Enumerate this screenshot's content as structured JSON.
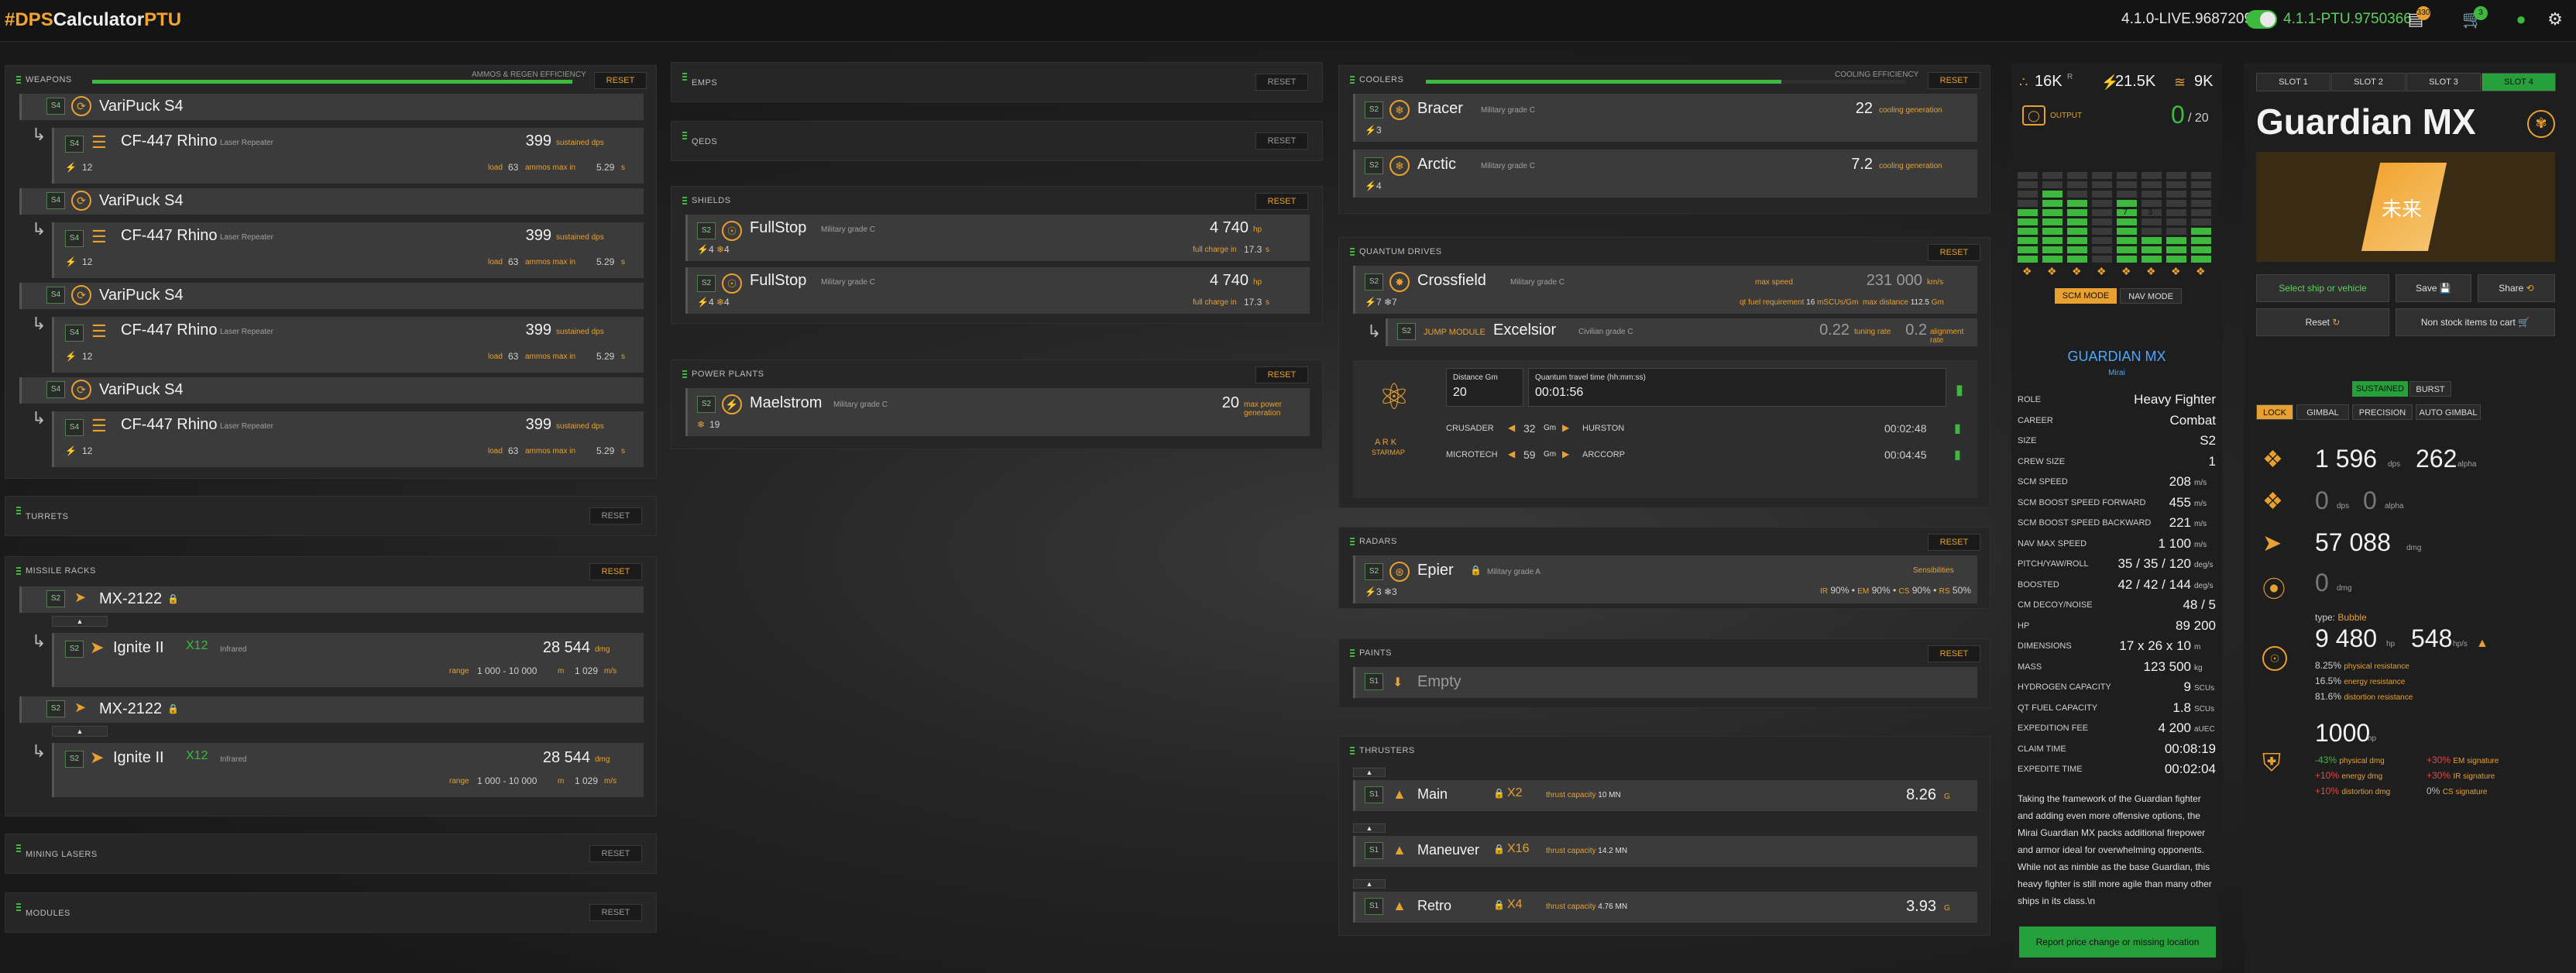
{
  "topbar": {
    "brand_prefix": "#DPS",
    "brand_mid": "Calculator",
    "brand_suffix": "PTU",
    "live_version": "4.1.0-LIVE.9687209",
    "ptu_version": "4.1.1-PTU.9750366",
    "notes_badge": "330",
    "cart_badge": "3"
  },
  "weapons": {
    "title": "WEAPONS",
    "efficiency_label": "AMMOS & REGEN EFFICIENCY",
    "reset": "RESET",
    "mounts": [
      {
        "size": "S4",
        "mount": "VariPuck S4",
        "wsize": "S4",
        "weapon": "CF-447 Rhino",
        "type": "Laser Repeater",
        "power": "12",
        "dps": "399",
        "dps_unit": "sustained dps",
        "load_label": "load",
        "ammo": "63",
        "ammo_label": "ammos max in",
        "time": "5.29",
        "time_unit": "s"
      },
      {
        "size": "S4",
        "mount": "VariPuck S4",
        "wsize": "S4",
        "weapon": "CF-447 Rhino",
        "type": "Laser Repeater",
        "power": "12",
        "dps": "399",
        "dps_unit": "sustained dps",
        "load_label": "load",
        "ammo": "63",
        "ammo_label": "ammos max in",
        "time": "5.29",
        "time_unit": "s"
      },
      {
        "size": "S4",
        "mount": "VariPuck S4",
        "wsize": "S4",
        "weapon": "CF-447 Rhino",
        "type": "Laser Repeater",
        "power": "12",
        "dps": "399",
        "dps_unit": "sustained dps",
        "load_label": "load",
        "ammo": "63",
        "ammo_label": "ammos max in",
        "time": "5.29",
        "time_unit": "s"
      },
      {
        "size": "S4",
        "mount": "VariPuck S4",
        "wsize": "S4",
        "weapon": "CF-447 Rhino",
        "type": "Laser Repeater",
        "power": "12",
        "dps": "399",
        "dps_unit": "sustained dps",
        "load_label": "load",
        "ammo": "63",
        "ammo_label": "ammos max in",
        "time": "5.29",
        "time_unit": "s"
      }
    ]
  },
  "turrets": {
    "title": "TURRETS",
    "reset": "RESET"
  },
  "missiles": {
    "title": "MISSILE RACKS",
    "reset": "RESET",
    "racks": [
      {
        "size": "S2",
        "rack": "MX-2122",
        "msize": "S2",
        "missile": "Ignite II",
        "count": "X12",
        "guidance": "Infrared",
        "dmg": "28 544",
        "dmg_unit": "dmg",
        "range_label": "range",
        "range": "1 000 - 10 000",
        "range_unit": "m",
        "speed": "1 029",
        "speed_unit": "m/s"
      },
      {
        "size": "S2",
        "rack": "MX-2122",
        "msize": "S2",
        "missile": "Ignite II",
        "count": "X12",
        "guidance": "Infrared",
        "dmg": "28 544",
        "dmg_unit": "dmg",
        "range_label": "range",
        "range": "1 000 - 10 000",
        "range_unit": "m",
        "speed": "1 029",
        "speed_unit": "m/s"
      }
    ]
  },
  "mining": {
    "title": "MINING LASERS",
    "reset": "RESET"
  },
  "modules": {
    "title": "MODULES",
    "reset": "RESET"
  },
  "emps": {
    "title": "EMPS",
    "reset": "RESET"
  },
  "qeds": {
    "title": "QEDS",
    "reset": "RESET"
  },
  "shields": {
    "title": "SHIELDS",
    "reset": "RESET",
    "items": [
      {
        "size": "S2",
        "name": "FullStop",
        "grade": "Military grade C",
        "power": "4",
        "cool": "4",
        "hp": "4 740",
        "hp_unit": "hp",
        "charge_label": "full charge in",
        "charge": "17.3",
        "charge_unit": "s"
      },
      {
        "size": "S2",
        "name": "FullStop",
        "grade": "Military grade C",
        "power": "4",
        "cool": "4",
        "hp": "4 740",
        "hp_unit": "hp",
        "charge_label": "full charge in",
        "charge": "17.3",
        "charge_unit": "s"
      }
    ]
  },
  "power": {
    "title": "POWER PLANTS",
    "reset": "RESET",
    "item": {
      "size": "S2",
      "name": "Maelstrom",
      "grade": "Military grade C",
      "cool": "19",
      "value": "20",
      "unit": "max power generation"
    }
  },
  "coolers": {
    "title": "COOLERS",
    "efficiency_label": "COOLING EFFICIENCY",
    "reset": "RESET",
    "items": [
      {
        "size": "S2",
        "name": "Bracer",
        "grade": "Military grade C",
        "power": "3",
        "value": "22",
        "unit": "cooling generation"
      },
      {
        "size": "S2",
        "name": "Arctic",
        "grade": "Military grade C",
        "power": "4",
        "value": "7.2",
        "unit": "cooling generation"
      }
    ]
  },
  "quantum": {
    "title": "QUANTUM DRIVES",
    "reset": "RESET",
    "drive": {
      "size": "S2",
      "name": "Crossfield",
      "grade": "Military grade C",
      "power": "7",
      "cool": "7",
      "speed_label": "max speed",
      "speed": "231 000",
      "speed_unit": "km/s",
      "fuel_label": "qt fuel requirement",
      "fuel": "16",
      "fuel_unit": "mSCUs/Gm",
      "dist_label": "max distance",
      "dist": "112.5",
      "dist_unit": "Gm"
    },
    "jump": {
      "size": "S2",
      "label": "JUMP MODULE",
      "name": "Excelsior",
      "grade": "Civilian grade C",
      "tuning": "0.22",
      "tuning_label": "tuning rate",
      "align": "0.2",
      "align_label": "alignment rate"
    },
    "calc": {
      "logo_text": "A R K",
      "logo_sub": "STARMAP",
      "distance_label": "Distance Gm",
      "distance": "20",
      "travel_label": "Quantum travel time (hh:mm:ss)",
      "travel": "00:01:56",
      "routes": [
        {
          "from": "CRUSADER",
          "dist": "32",
          "unit": "Gm",
          "to": "HURSTON",
          "time": "00:02:48"
        },
        {
          "from": "MICROTECH",
          "dist": "59",
          "unit": "Gm",
          "to": "ARCCORP",
          "time": "00:04:45"
        }
      ]
    }
  },
  "radars": {
    "title": "RADARS",
    "reset": "RESET",
    "item": {
      "size": "S2",
      "name": "Epier",
      "grade": "Military grade A",
      "power": "3",
      "cool": "3",
      "sens_label": "Sensibilities",
      "ir": "90%",
      "em": "90%",
      "cs": "90%",
      "rs": "50%"
    }
  },
  "paints": {
    "title": "PAINTS",
    "reset": "RESET",
    "item": {
      "size": "S1",
      "name": "Empty"
    }
  },
  "thrusters": {
    "title": "THRUSTERS",
    "items": [
      {
        "size": "S1",
        "name": "Main",
        "count": "X2",
        "cap_label": "thrust capacity",
        "cap": "10",
        "cap_unit": "MN",
        "value": "8.26",
        "unit": "G"
      },
      {
        "size": "S1",
        "name": "Maneuver",
        "count": "X16",
        "cap_label": "thrust capacity",
        "cap": "14.2",
        "cap_unit": "MN",
        "value": "",
        "unit": ""
      },
      {
        "size": "S1",
        "name": "Retro",
        "count": "X4",
        "cap_label": "thrust capacity",
        "cap": "4.76",
        "cap_unit": "MN",
        "value": "3.93",
        "unit": "G"
      }
    ]
  },
  "ship_stats": {
    "power_total": "16K",
    "power_sup": "R",
    "power2": "21.5K",
    "power3": "9K",
    "output_label": "OUTPUT",
    "output_value": "0",
    "output_max": "/ 20",
    "bars": [
      6,
      8,
      7,
      0,
      7,
      3,
      3,
      4
    ],
    "bar_labels": [
      "",
      "",
      "",
      "",
      "7",
      "3",
      "",
      ""
    ],
    "mode_scm": "SCM MODE",
    "mode_nav": "NAV MODE",
    "ship_name": "GUARDIAN MX",
    "maker": "Mirai",
    "rows": [
      {
        "label": "ROLE",
        "value": "Heavy Fighter",
        "unit": ""
      },
      {
        "label": "CAREER",
        "value": "Combat",
        "unit": ""
      },
      {
        "label": "SIZE",
        "value": "S2",
        "unit": ""
      },
      {
        "label": "CREW SIZE",
        "value": "1",
        "unit": ""
      },
      {
        "label": "SCM SPEED",
        "value": "208",
        "unit": "m/s"
      },
      {
        "label": "SCM BOOST SPEED FORWARD",
        "value": "455",
        "unit": "m/s"
      },
      {
        "label": "SCM BOOST SPEED BACKWARD",
        "value": "221",
        "unit": "m/s"
      },
      {
        "label": "NAV MAX SPEED",
        "value": "1 100",
        "unit": "m/s"
      },
      {
        "label": "PITCH/YAW/ROLL",
        "value": "35 / 35 / 120",
        "unit": "deg/s"
      },
      {
        "label": "BOOSTED",
        "value": "42 / 42 / 144",
        "unit": "deg/s"
      },
      {
        "label": "CM DECOY/NOISE",
        "value": "48 / 5",
        "unit": ""
      },
      {
        "label": "HP",
        "value": "89 200",
        "unit": ""
      },
      {
        "label": "DIMENSIONS",
        "value": "17 x 26 x 10",
        "unit": "m"
      },
      {
        "label": "MASS",
        "value": "123 500",
        "unit": "kg"
      },
      {
        "label": "HYDROGEN CAPACITY",
        "value": "9",
        "unit": "SCUs"
      },
      {
        "label": "QT FUEL CAPACITY",
        "value": "1.8",
        "unit": "SCUs"
      },
      {
        "label": "EXPEDITION FEE",
        "value": "4 200",
        "unit": "aUEC"
      },
      {
        "label": "CLAIM TIME",
        "value": "00:08:19",
        "unit": ""
      },
      {
        "label": "EXPEDITE TIME",
        "value": "00:02:04",
        "unit": ""
      }
    ],
    "description": "Taking the framework of the Guardian fighter and adding even more offensive options, the Mirai Guardian MX packs additional firepower and armor ideal for overwhelming opponents. While not as nimble as the base Guardian, this heavy fighter is still more agile than many other ships in its class.\\n",
    "report_button": "Report price change or missing location"
  },
  "right": {
    "slots": [
      "SLOT 1",
      "SLOT 2",
      "SLOT 3",
      "SLOT 4"
    ],
    "ship_title": "Guardian MX",
    "select_button": "Select ship or vehicle",
    "save_button": "Save",
    "share_button": "Share",
    "reset_button": "Reset",
    "cart_button": "Non stock items to cart",
    "mode_sustained": "SUSTAINED",
    "mode_burst": "BURST",
    "aim_modes": [
      "LOCK",
      "GIMBAL",
      "PRECISION",
      "AUTO GIMBAL"
    ],
    "weapon_dps": "1 596",
    "weapon_dps_unit": "dps",
    "weapon_alpha": "262",
    "weapon_alpha_unit": "alpha",
    "missile_dps": "0",
    "missile_dps_unit": "dps",
    "missile_alpha": "0",
    "missile_alpha_unit": "alpha",
    "missile_dmg": "57 088",
    "missile_dmg_unit": "dmg",
    "emp_dmg": "0",
    "emp_dmg_unit": "dmg",
    "shield_type_label": "type:",
    "shield_type": "Bubble",
    "shield_hp": "9 480",
    "shield_hp_unit": "hp",
    "shield_regen": "548",
    "shield_regen_unit": "hp/s",
    "res1": "8.25%",
    "res1_label": "physical resistance",
    "res2": "16.5%",
    "res2_label": "energy resistance",
    "res3": "81.6%",
    "res3_label": "distortion resistance",
    "armor_hp": "1000",
    "armor_hp_unit": "hp",
    "armor": [
      {
        "a": "-43%",
        "a_label": "physical dmg",
        "b": "+30%",
        "b_label": "EM signature"
      },
      {
        "a": "+10%",
        "a_label": "energy dmg",
        "b": "+30%",
        "b_label": "IR signature"
      },
      {
        "a": "+10%",
        "a_label": "distortion dmg",
        "b": "0%",
        "b_label": "CS signature"
      }
    ],
    "image_text": "未来"
  },
  "colors": {
    "accent": "#e8a030",
    "green": "#3dba3d",
    "bg": "#1c1c1c"
  }
}
